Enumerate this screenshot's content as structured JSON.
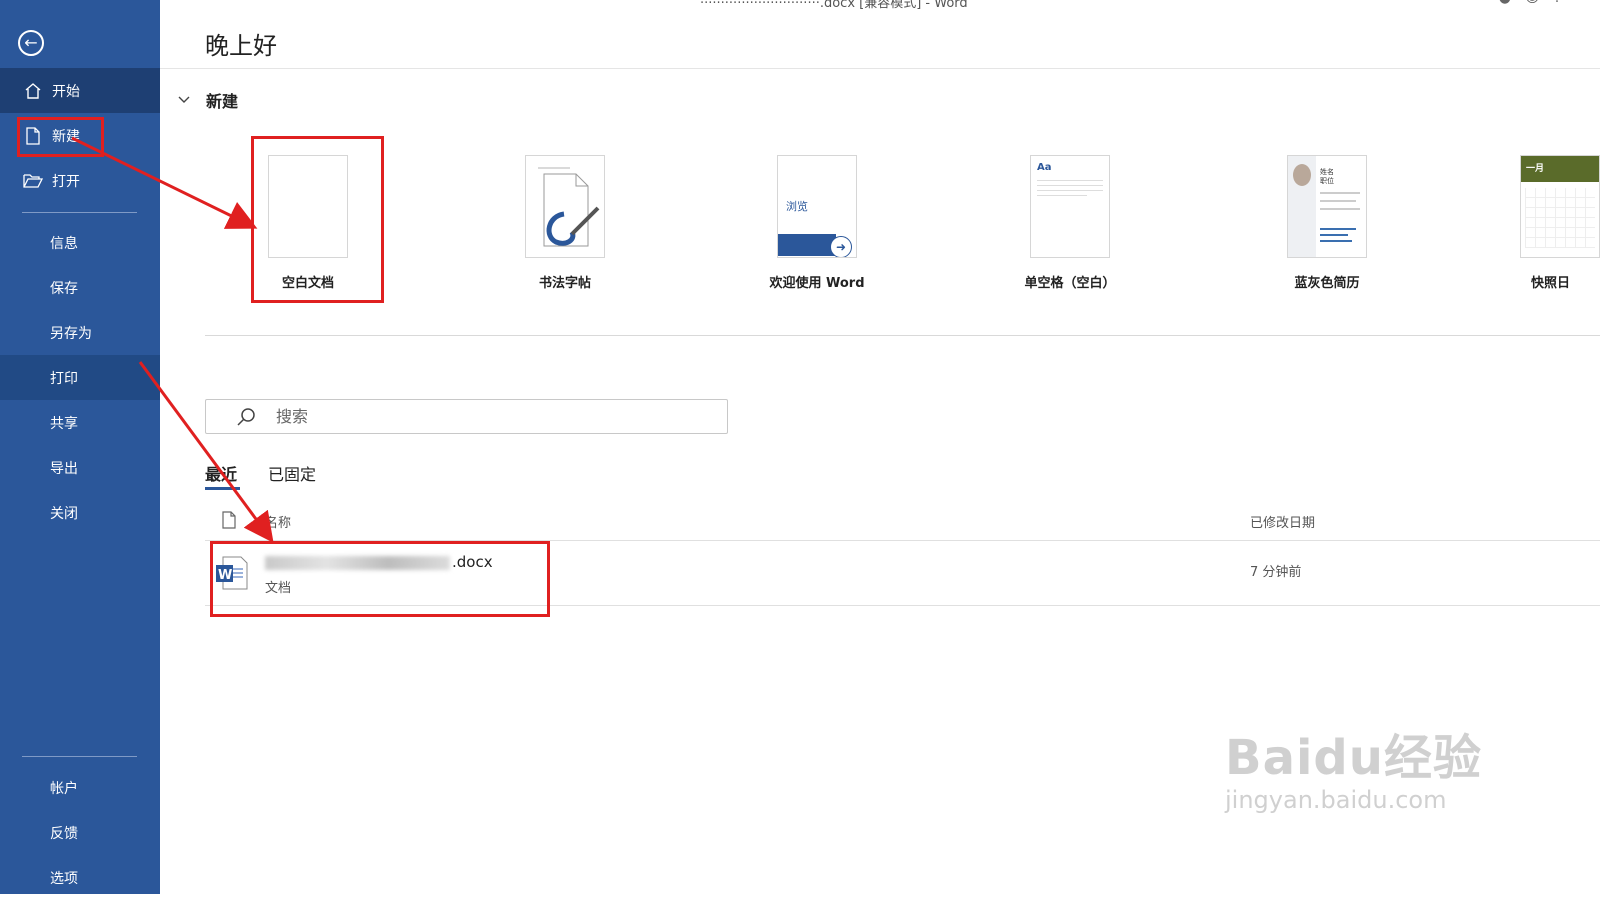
{
  "titlebar": {
    "text": "·····························.docx [兼容模式] - Word"
  },
  "sidebar": {
    "back_label": "←",
    "items": [
      {
        "label": "开始",
        "icon": "home-icon",
        "state": "active"
      },
      {
        "label": "新建",
        "icon": "new-document-icon",
        "state": ""
      },
      {
        "label": "打开",
        "icon": "open-folder-icon",
        "state": ""
      },
      {
        "label": "信息"
      },
      {
        "label": "保存"
      },
      {
        "label": "另存为"
      },
      {
        "label": "打印",
        "state": "hover"
      },
      {
        "label": "共享"
      },
      {
        "label": "导出"
      },
      {
        "label": "关闭"
      },
      {
        "label": "帐户"
      },
      {
        "label": "反馈"
      },
      {
        "label": "选项"
      }
    ]
  },
  "main": {
    "greeting": "晚上好",
    "section_title": "新建",
    "templates": [
      {
        "name": "空白文档"
      },
      {
        "name": "书法字帖"
      },
      {
        "name": "欢迎使用 Word",
        "thumb_text": "浏览"
      },
      {
        "name": "单空格（空白）",
        "thumb_text": "Aa"
      },
      {
        "name": "蓝灰色简历",
        "thumb_text": "姓名\n职位"
      },
      {
        "name": "快照日",
        "thumb_text": "一月"
      }
    ],
    "search": {
      "placeholder": "搜索"
    },
    "tabs": [
      {
        "label": "最近",
        "active": true
      },
      {
        "label": "已固定"
      }
    ],
    "columns": {
      "name": "名称",
      "modified": "已修改日期"
    },
    "files": [
      {
        "name_suffix": ".docx",
        "type": "文档",
        "modified": "7 分钟前"
      }
    ]
  },
  "watermark": {
    "main": "Baidu经验",
    "sub": "jingyan.baidu.com"
  },
  "colors": {
    "sidebar": "#2b579a",
    "active": "#1e3f73",
    "annotation": "#e02020"
  }
}
